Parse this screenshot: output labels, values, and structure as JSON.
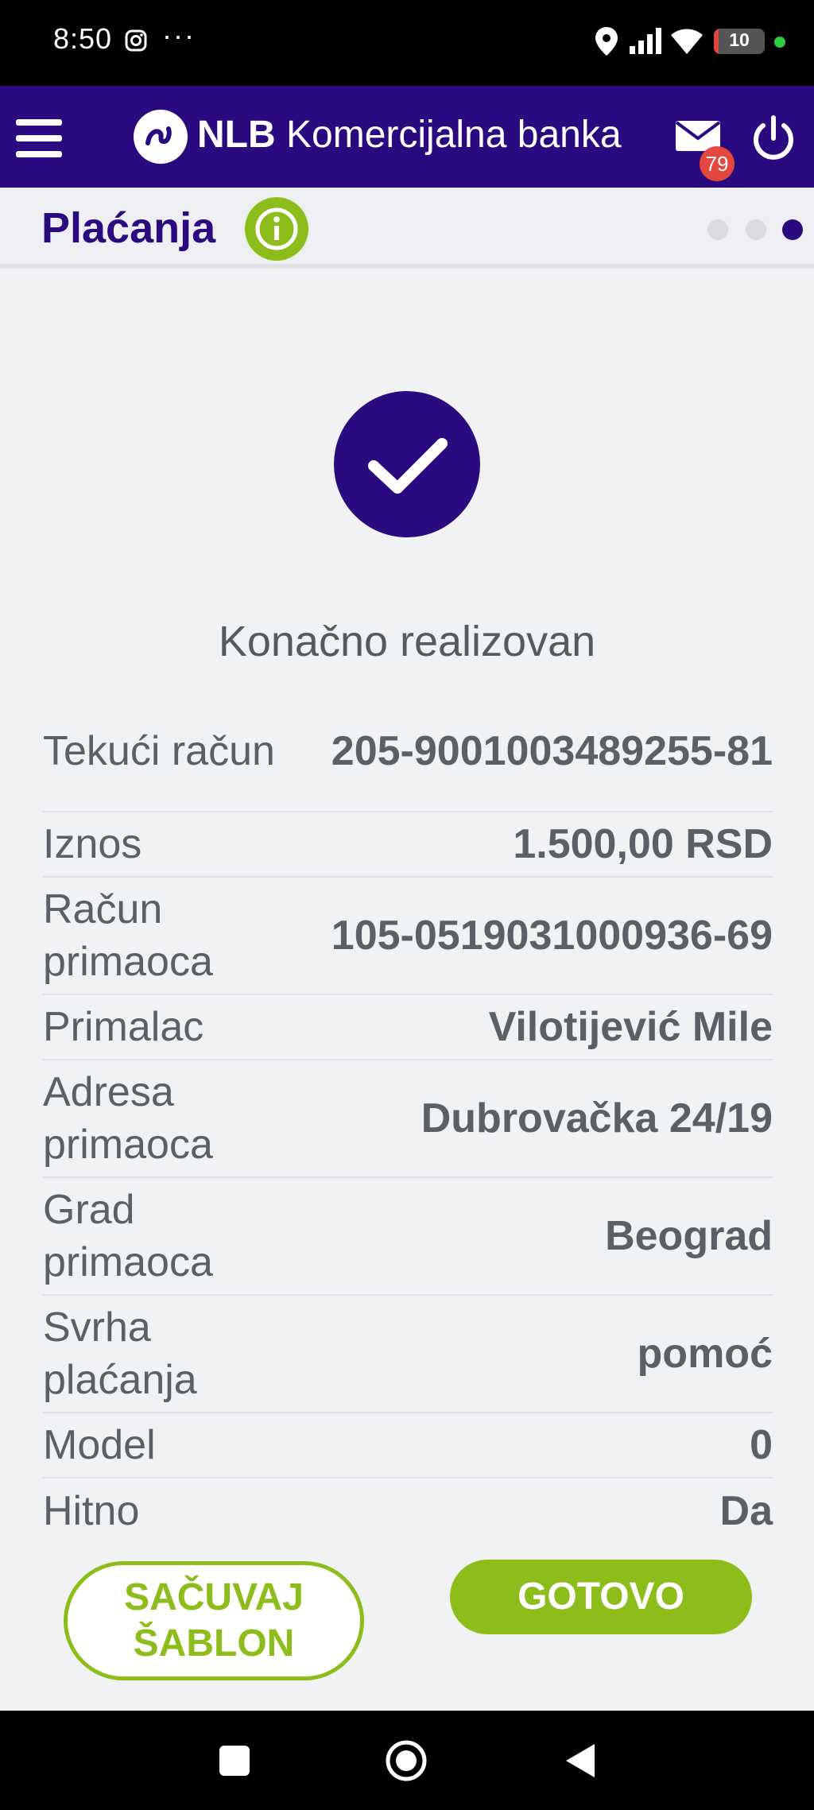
{
  "status_bar": {
    "time": "8:50",
    "more": "···",
    "battery_level": "10",
    "battery_fraction": 0.1
  },
  "header": {
    "bank_name_bold": "NLB",
    "bank_name_rest": " Komercijalna banka",
    "unread_messages": "79"
  },
  "page": {
    "title": "Plaćanja",
    "steps_total": 3,
    "current_step": 3
  },
  "result": {
    "status": "Konačno realizovan"
  },
  "details": [
    {
      "label": "Tekući račun",
      "value": "205-9001003489255-81"
    },
    {
      "label": "Iznos",
      "value": "1.500,00 RSD"
    },
    {
      "label": "Račun primaoca",
      "value": "105-0519031000936-69"
    },
    {
      "label": "Primalac",
      "value": "Vilotijević Mile"
    },
    {
      "label": "Adresa primaoca",
      "value": "Dubrovačka 24/19"
    },
    {
      "label": "Grad primaoca",
      "value": "Beograd"
    },
    {
      "label": "Svrha plaćanja",
      "value": "pomoć"
    },
    {
      "label": "Model",
      "value": "0"
    },
    {
      "label": "Hitno",
      "value": "Da"
    }
  ],
  "actions": {
    "save_template_line1": "SAČUVAJ",
    "save_template_line2": "ŠABLON",
    "done": "GOTOVO"
  },
  "colors": {
    "brand_primary": "#2a0a7e",
    "accent_green": "#8cbd1a",
    "badge_red": "#e4473e",
    "text_gray": "#5b6066",
    "background": "#f1f2f4"
  },
  "icons": {
    "menu": "hamburger-menu-icon",
    "messages": "envelope-icon",
    "logout": "power-icon",
    "info": "info-icon",
    "success": "checkmark-icon"
  }
}
